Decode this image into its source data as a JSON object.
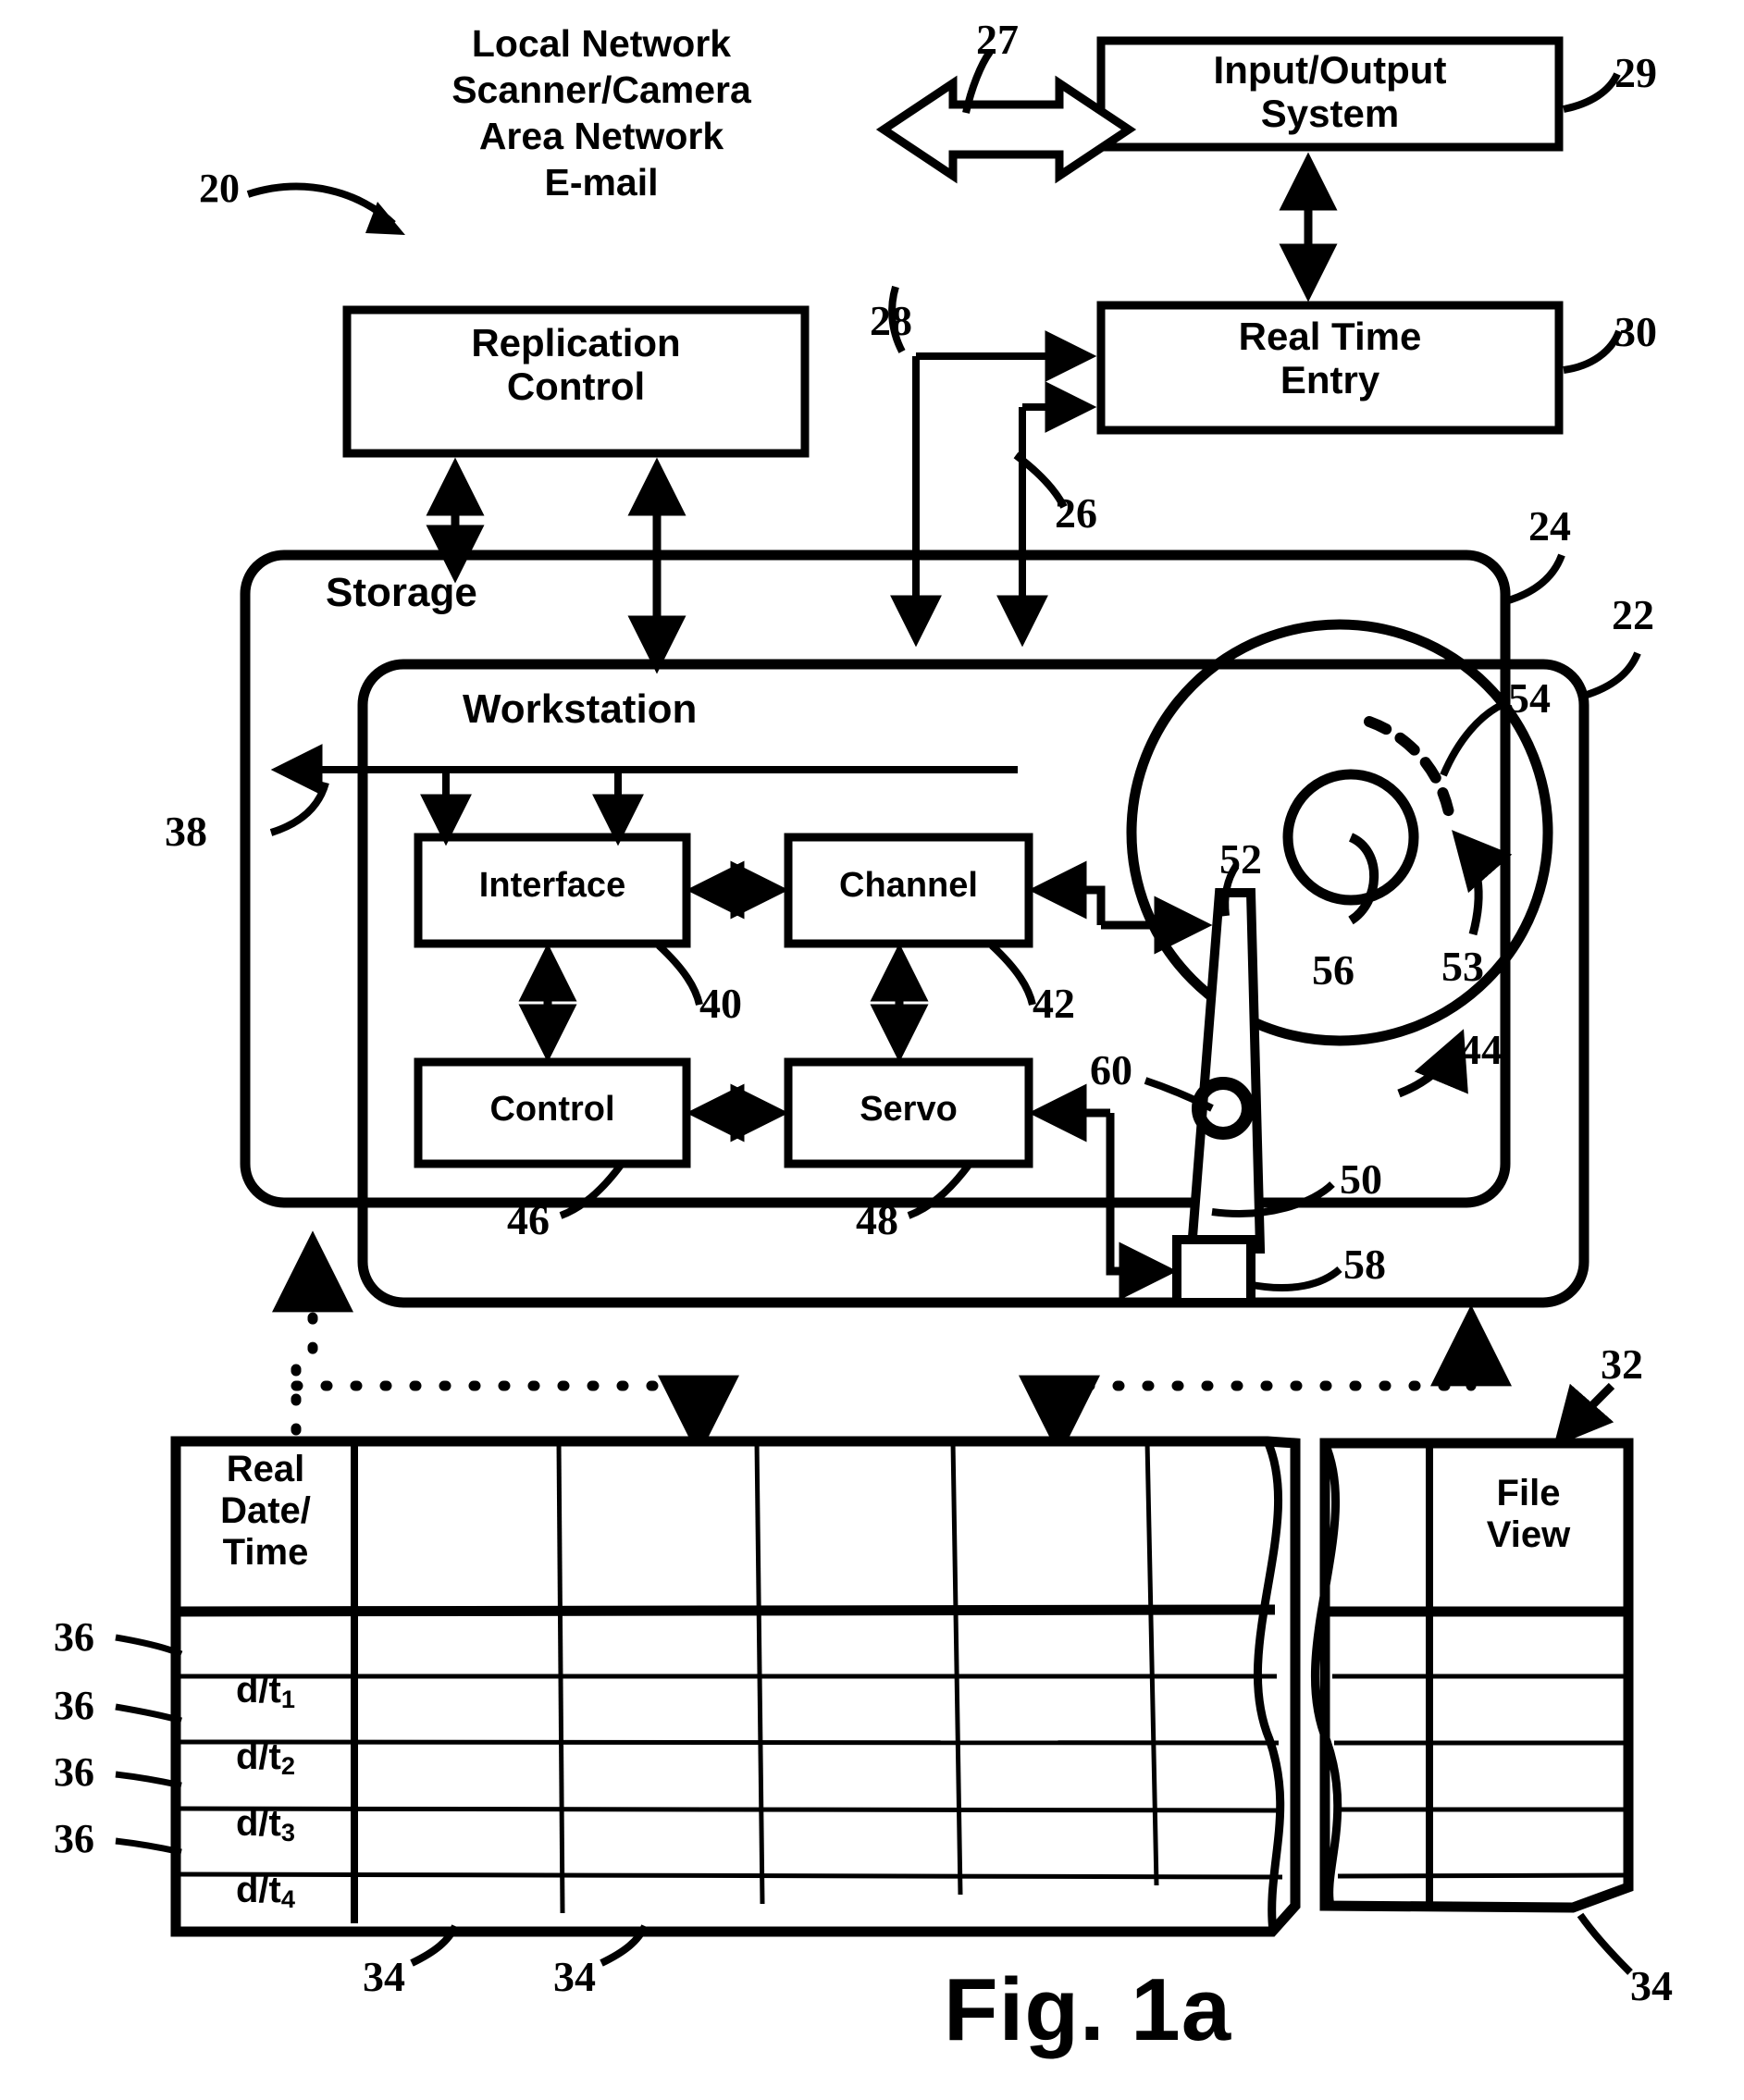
{
  "figure": {
    "caption": "Fig. 1a",
    "system_ref": "20"
  },
  "network_sources": {
    "lines": "Local Network\nScanner/Camera\nArea Network\nE-mail",
    "link_ref": "27"
  },
  "blocks": [
    {
      "id": "io-system",
      "label": "Input/Output\nSystem",
      "ref": "29"
    },
    {
      "id": "replication-control",
      "label": "Replication\nControl",
      "ref": ""
    },
    {
      "id": "real-time-entry",
      "label": "Real Time\nEntry",
      "ref": "30"
    },
    {
      "id": "storage",
      "label": "Storage",
      "ref": "24"
    },
    {
      "id": "workstation",
      "label": "Workstation",
      "ref": "22"
    },
    {
      "id": "interface",
      "label": "Interface",
      "ref": "40"
    },
    {
      "id": "channel",
      "label": "Channel",
      "ref": "42"
    },
    {
      "id": "control",
      "label": "Control",
      "ref": "46"
    },
    {
      "id": "servo",
      "label": "Servo",
      "ref": "48"
    }
  ],
  "refs": {
    "system": "20",
    "network_link": "27",
    "io_system": "29",
    "entry_path": "28",
    "real_time_entry": "30",
    "storage_feed": "26",
    "storage": "24",
    "workstation": "22",
    "storage_return": "38",
    "interface": "40",
    "channel": "42",
    "control": "46",
    "servo": "48",
    "disk": "44",
    "actuator": "50",
    "head": "52",
    "rotation": "53",
    "track": "54",
    "spindle": "56",
    "voice_coil": "58",
    "pivot": "60",
    "table": "32",
    "column": "34",
    "row": "36"
  },
  "table": {
    "ref": "32",
    "column_ref": "34",
    "row_ref": "36",
    "headers": [
      "Real\nDate/\nTime",
      "",
      "",
      "",
      "",
      "",
      "",
      "File\nView"
    ],
    "rows": [
      {
        "label": "d/t",
        "sub": "1"
      },
      {
        "label": "d/t",
        "sub": "2"
      },
      {
        "label": "d/t",
        "sub": "3"
      },
      {
        "label": "d/t",
        "sub": "4"
      },
      {
        "label": "",
        "sub": ""
      }
    ],
    "column_refs": [
      "34",
      "34",
      "34"
    ]
  },
  "colors": {
    "ink": "#000000",
    "paper": "#ffffff"
  }
}
